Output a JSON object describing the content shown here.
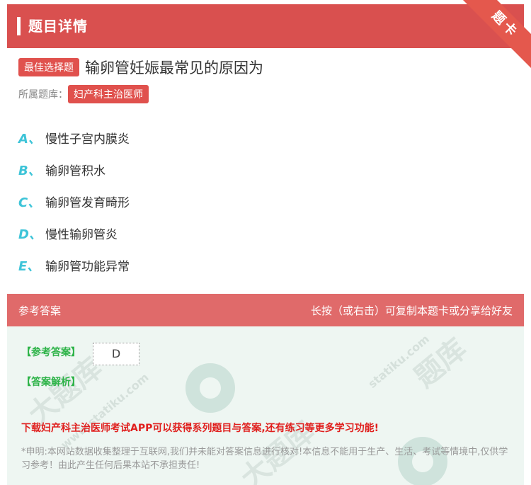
{
  "header": {
    "title": "题目详情",
    "ribbon": "题卡"
  },
  "question": {
    "type_tag": "最佳选择题",
    "text": "输卵管妊娠最常见的原因为",
    "bank_label": "所属题库：",
    "bank_name": "妇产科主治医师"
  },
  "options": [
    {
      "letter": "A、",
      "text": "慢性子宫内膜炎"
    },
    {
      "letter": "B、",
      "text": "输卵管积水"
    },
    {
      "letter": "C、",
      "text": "输卵管发育畸形"
    },
    {
      "letter": "D、",
      "text": "慢性输卵管炎"
    },
    {
      "letter": "E、",
      "text": "输卵管功能异常"
    }
  ],
  "answer_bar": {
    "left": "参考答案",
    "right": "长按（或右击）可复制本题卡或分享给好友"
  },
  "answer": {
    "ref_label": "【参考答案】",
    "ref_value": "D",
    "analysis_label": "【答案解析】",
    "promo": "下载妇产科主治医师考试APP可以获得系列题目与答案,还有练习等更多学习功能!",
    "disclaimer": "*申明:本网站数据收集整理于互联网,我们并未能对答案信息进行核对!本信息不能用于生产、生活、考试等情境中,仅供学习参考！由此产生任何后果本站不承担责任!"
  },
  "colors": {
    "brand": "#d9504f",
    "option_letter": "#3ec4d8",
    "answer_green": "#2db348",
    "promo_red": "#e0201e"
  }
}
